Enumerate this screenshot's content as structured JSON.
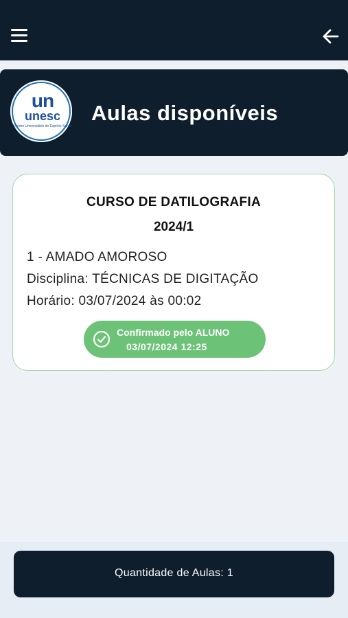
{
  "header": {
    "title": "Aulas disponíveis",
    "logo": {
      "mark": "un",
      "word": "unesc",
      "subtitle": "Centro Universitário do Espírito Santo"
    }
  },
  "lesson": {
    "course": "CURSO DE DATILOGRAFIA",
    "period": "2024/1",
    "lesson_line": "1 - AMADO AMOROSO",
    "discipline_line": "Disciplina: TÉCNICAS DE DIGITAÇÃO",
    "schedule_line": "Horário: 03/07/2024 às 00:02",
    "status": {
      "label": "Confirmado pelo ALUNO",
      "datetime": "03/07/2024 12:25",
      "color": "#6cc276"
    }
  },
  "footer": {
    "count_label": "Quantidade de Aulas: 1"
  },
  "colors": {
    "dark": "#0f1e2d",
    "background": "#eef2f6",
    "brand": "#1d4f9c"
  },
  "icons": {
    "menu": "hamburger-icon",
    "back": "arrow-left-icon",
    "status": "check-circle-icon"
  }
}
